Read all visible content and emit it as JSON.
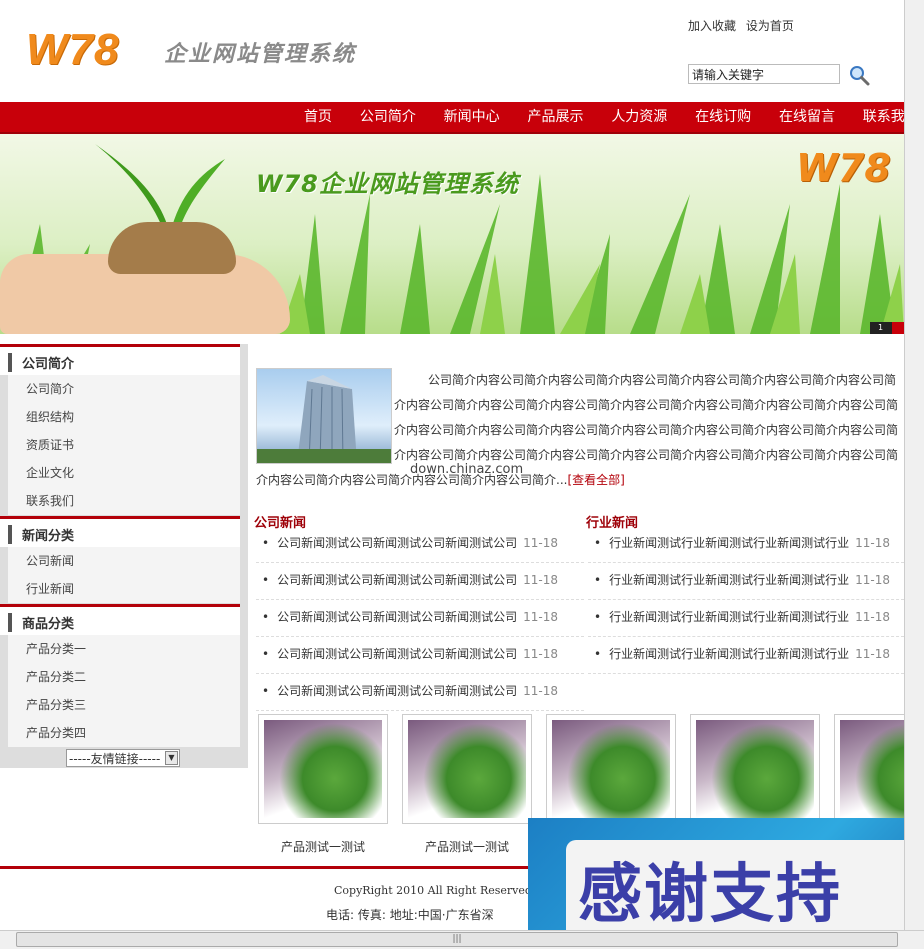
{
  "header": {
    "logo": "W78",
    "logo_subtitle": "企业网站管理系统",
    "top_links": [
      "加入收藏",
      "设为首页"
    ],
    "search_placeholder": "请输入关键字"
  },
  "nav": [
    "首页",
    "公司简介",
    "新闻中心",
    "产品展示",
    "人力资源",
    "在线订购",
    "在线留言",
    "联系我们"
  ],
  "banner": {
    "title": "W78企业网站管理系统",
    "logo": "W78",
    "slide_index": "1"
  },
  "sidebar": {
    "sections": [
      {
        "title": "公司简介",
        "items": [
          "公司简介",
          "组织结构",
          "资质证书",
          "企业文化",
          "联系我们"
        ]
      },
      {
        "title": "新闻分类",
        "items": [
          "公司新闻",
          "行业新闻"
        ]
      },
      {
        "title": "商品分类",
        "items": [
          "产品分类一",
          "产品分类二",
          "产品分类三",
          "产品分类四"
        ]
      }
    ],
    "friend_links": "-----友情链接-----"
  },
  "about": {
    "text": "公司简介内容公司简介内容公司简介内容公司简介内容公司简介内容公司简介内容公司简介内容公司简介内容公司简介内容公司简介内容公司简介内容公司简介内容公司简介内容公司简介内容公司简介内容公司简介内容公司简介内容公司简介内容公司简介内容公司简介内容公司简介内容公司简介内容公司简介内容公司简介内容公司简介内容公司简介内容公司简介内容公司简介内容公司简介内容公司简介内容公司简介内容公司简介...",
    "more": "[查看全部]",
    "watermark": "down.chinaz.com"
  },
  "company_news": {
    "title": "公司新闻",
    "items": [
      {
        "title": "公司新闻测试公司新闻测试公司新闻测试公司",
        "date": "11-18"
      },
      {
        "title": "公司新闻测试公司新闻测试公司新闻测试公司",
        "date": "11-18"
      },
      {
        "title": "公司新闻测试公司新闻测试公司新闻测试公司",
        "date": "11-18"
      },
      {
        "title": "公司新闻测试公司新闻测试公司新闻测试公司",
        "date": "11-18"
      },
      {
        "title": "公司新闻测试公司新闻测试公司新闻测试公司",
        "date": "11-18"
      }
    ]
  },
  "industry_news": {
    "title": "行业新闻",
    "items": [
      {
        "title": "行业新闻测试行业新闻测试行业新闻测试行业",
        "date": "11-18"
      },
      {
        "title": "行业新闻测试行业新闻测试行业新闻测试行业",
        "date": "11-18"
      },
      {
        "title": "行业新闻测试行业新闻测试行业新闻测试行业",
        "date": "11-18"
      },
      {
        "title": "行业新闻测试行业新闻测试行业新闻测试行业",
        "date": "11-18"
      }
    ]
  },
  "products": [
    "产品测试一测试",
    "产品测试一测试",
    "",
    "",
    ""
  ],
  "footer": {
    "copyright": "CopyRight 2010 All Right Reserved",
    "contact": "电话:  传真:  地址:中国·广东省深"
  },
  "overlay": {
    "text": "感谢支持"
  },
  "colors": {
    "brand_red": "#c8000a",
    "logo_orange": "#f08a1c"
  }
}
